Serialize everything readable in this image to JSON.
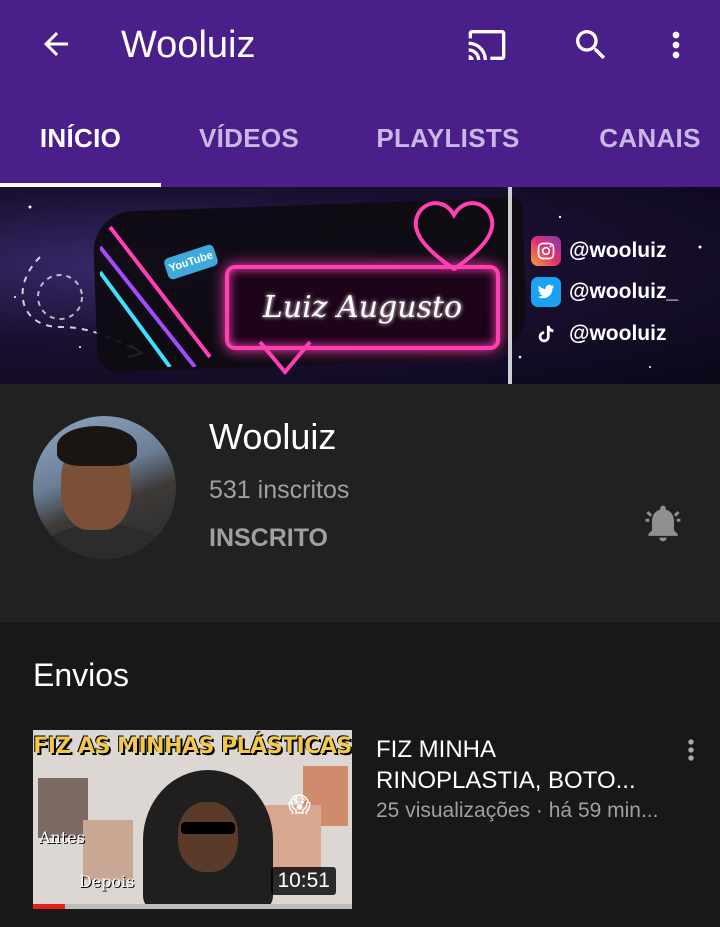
{
  "app_bar": {
    "title": "Wooluiz",
    "icons": [
      "back-arrow-icon",
      "cast-icon",
      "search-icon",
      "more-vert-icon"
    ]
  },
  "tabs": [
    {
      "label": "INÍCIO",
      "active": true
    },
    {
      "label": "VÍDEOS",
      "active": false
    },
    {
      "label": "PLAYLISTS",
      "active": false
    },
    {
      "label": "CANAIS",
      "active": false
    }
  ],
  "banner": {
    "name_script": "Luiz Augusto",
    "badge": "YouTube",
    "socials": [
      {
        "icon": "instagram-icon",
        "handle": "@wooluiz"
      },
      {
        "icon": "twitter-icon",
        "handle": "@wooluiz_"
      },
      {
        "icon": "tiktok-icon",
        "handle": "@wooluiz"
      }
    ]
  },
  "channel": {
    "name": "Wooluiz",
    "subscribers": "531 inscritos",
    "subscribe_status": "INSCRITO"
  },
  "uploads": {
    "section_title": "Envios",
    "videos": [
      {
        "title_line1": "FIZ MINHA",
        "title_line2": "RINOPLASTIA, BOTO...",
        "meta": "25 visualizações · há 59 min...",
        "duration": "10:51",
        "thumbnail_headline": "FIZ AS MINHAS PLÁSTICAS",
        "thumbnail_label_before": "Antes",
        "thumbnail_label_after": "Depois",
        "watch_progress": 0.1
      }
    ]
  },
  "colors": {
    "app_bar": "#4a1f8a",
    "tab_inactive": "#c8b8e6",
    "channel_bg": "#212121",
    "page_bg": "#181818",
    "neon_pink": "#ff3fb4",
    "progress_red": "#e62117"
  }
}
